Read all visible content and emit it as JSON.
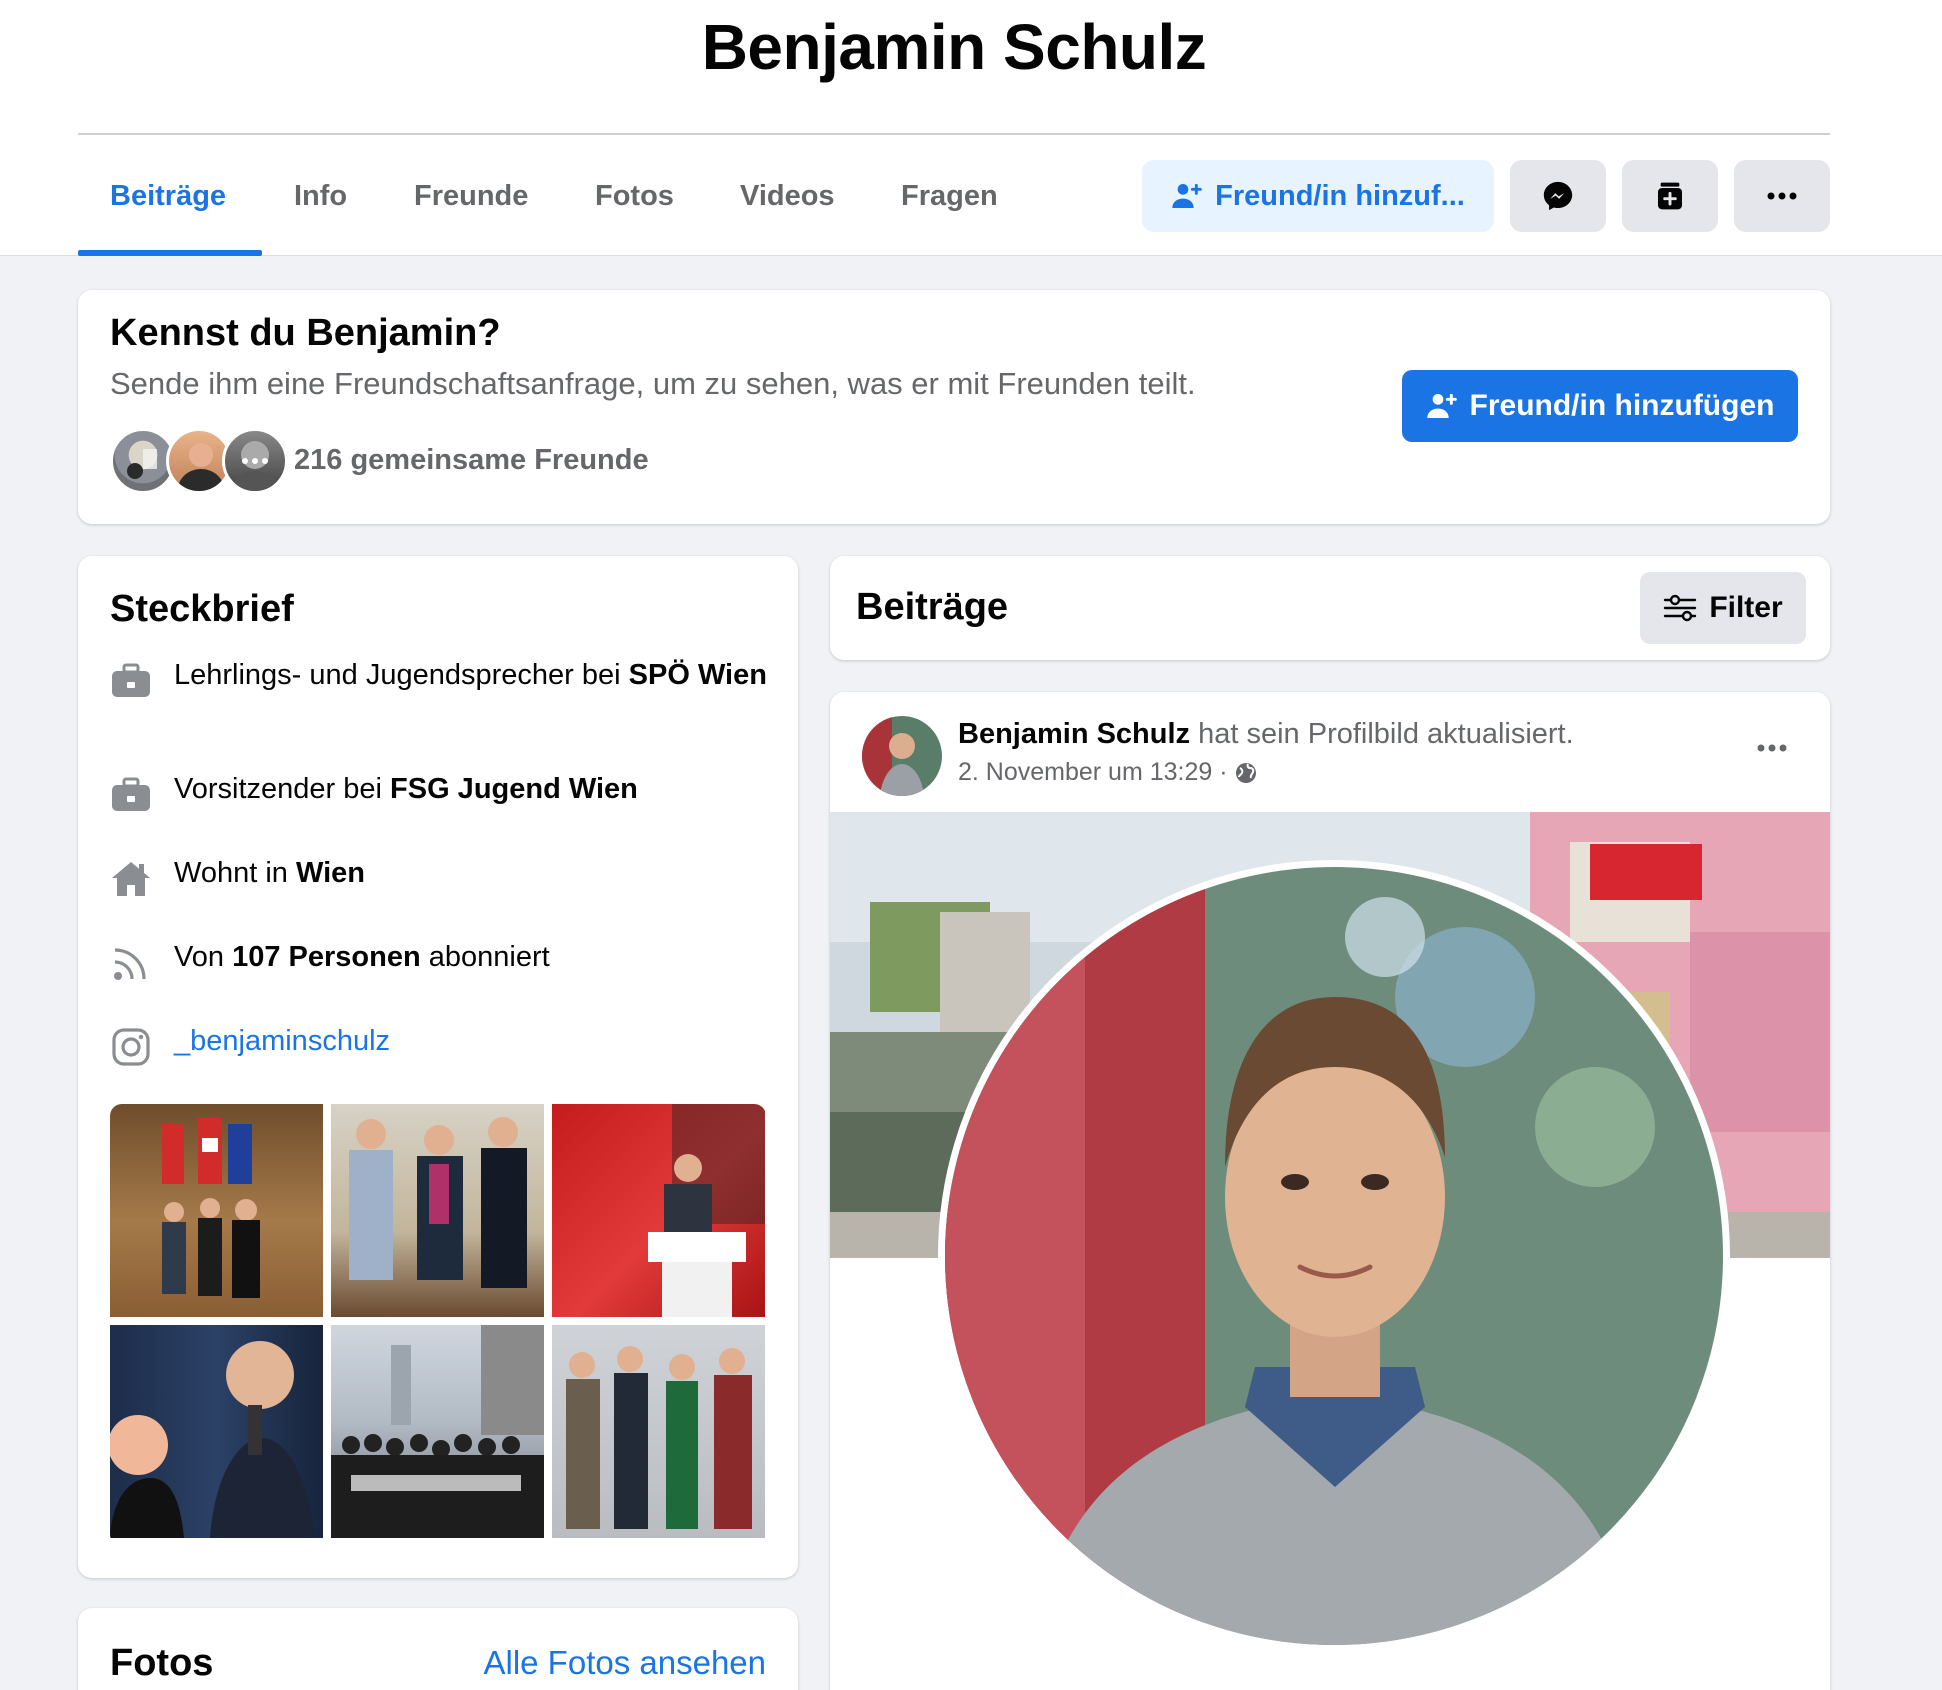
{
  "profile": {
    "name": "Benjamin Schulz"
  },
  "tabs": [
    {
      "label": "Beiträge"
    },
    {
      "label": "Info"
    },
    {
      "label": "Freunde"
    },
    {
      "label": "Fotos"
    },
    {
      "label": "Videos"
    },
    {
      "label": "Fragen"
    }
  ],
  "actions": {
    "add_friend_short": "Freund/in hinzuf...",
    "messenger_icon": "messenger-icon",
    "save_icon": "save-icon",
    "more_icon": "more-icon"
  },
  "know_card": {
    "title": "Kennst du Benjamin?",
    "subtitle": "Sende ihm eine Freundschaftsanfrage, um zu sehen, was er mit Freunden teilt.",
    "mutual_friends": "216 gemeinsame Freunde",
    "add_friend": "Freund/in hinzufügen"
  },
  "steckbrief": {
    "title": "Steckbrief",
    "items": [
      {
        "icon": "briefcase-icon",
        "prefix": "Lehrlings- und Jugendsprecher bei ",
        "bold": "SPÖ Wien",
        "suffix": ""
      },
      {
        "icon": "briefcase-icon",
        "prefix": "Vorsitzender bei ",
        "bold": "FSG Jugend Wien",
        "suffix": ""
      },
      {
        "icon": "home-icon",
        "prefix": "Wohnt in ",
        "bold": "Wien",
        "suffix": ""
      },
      {
        "icon": "rss-icon",
        "prefix": "Von ",
        "bold": "107 Personen",
        "suffix": " abonniert"
      },
      {
        "icon": "instagram-icon",
        "link": "_benjaminschulz"
      }
    ]
  },
  "fotos_card": {
    "title": "Fotos",
    "link": "Alle Fotos ansehen"
  },
  "posts_header": {
    "title": "Beiträge",
    "filter": "Filter"
  },
  "post": {
    "author": "Benjamin Schulz",
    "action": " hat sein Profilbild aktualisiert.",
    "date": "2. November um 13:29 · ",
    "privacy_icon": "globe-icon"
  },
  "colors": {
    "accent": "#1b74e4",
    "accent_light": "#e7f3ff",
    "secondary_text": "#65676b",
    "button_grey": "#e4e6eb",
    "page_bg": "#f0f2f5"
  }
}
